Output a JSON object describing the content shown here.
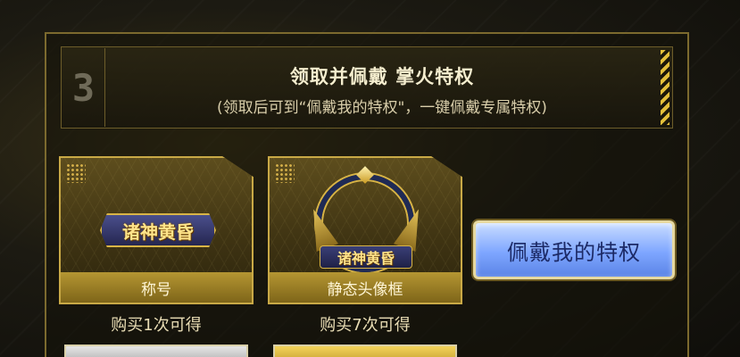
{
  "section": {
    "step_number": "3",
    "title": "领取并佩戴 掌火特权",
    "subtitle": "(领取后可到“佩戴我的特权\"，一键佩戴专属特权)"
  },
  "rewards": [
    {
      "name": "称号",
      "badge_text": "诸神黄昏",
      "condition": "购买1次可得"
    },
    {
      "name": "静态头像框",
      "badge_text": "诸神黄昏",
      "condition": "购买7次可得"
    }
  ],
  "wear_button": {
    "label": "佩戴我的特权"
  },
  "colors": {
    "gold": "#c9a946",
    "button_blue": "#7ea6ff",
    "hazard_yellow": "#e3bf3a"
  }
}
